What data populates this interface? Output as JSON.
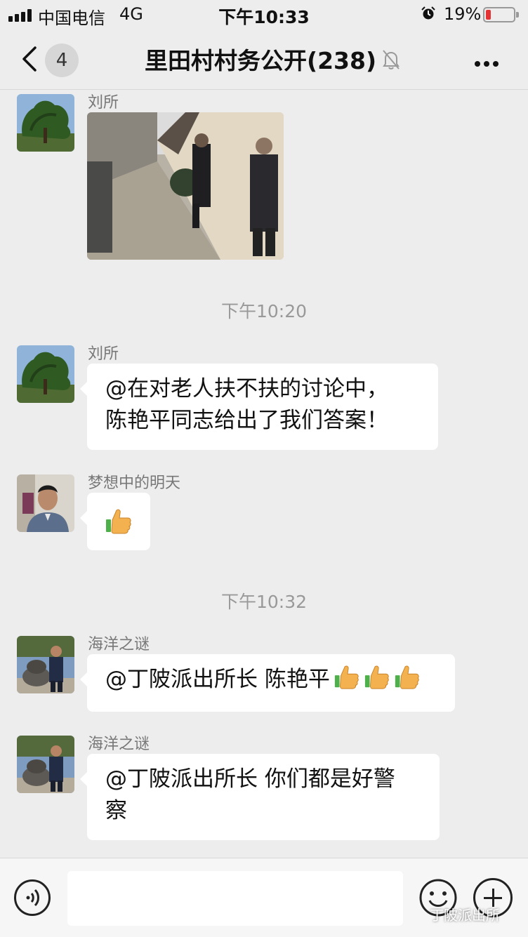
{
  "status_bar": {
    "carrier": "中国电信",
    "network": "4G",
    "time": "下午10:33",
    "battery": "19%",
    "battery_level": 0.19,
    "battery_color": "#e53333"
  },
  "nav": {
    "unread_count": "4",
    "title": "里田村村务公开(238)",
    "icons": [
      "back-arrow-icon",
      "mute-bell-icon",
      "more-icon"
    ]
  },
  "messages": [
    {
      "type": "image",
      "sender": "刘所",
      "image_desc": "street photo"
    },
    {
      "type": "time",
      "text": "下午10:20"
    },
    {
      "type": "text",
      "sender": "刘所",
      "lines": [
        "@在对老人扶不扶的讨论中，",
        "陈艳平同志给出了我们答案！"
      ]
    },
    {
      "type": "emoji",
      "sender": "梦想中的明天",
      "emoji": "thumbs-up"
    },
    {
      "type": "time",
      "text": "下午10:32"
    },
    {
      "type": "text",
      "sender": "海洋之谜",
      "text": "@丁陂派出所长 陈艳平",
      "emoji_count": 3
    },
    {
      "type": "text",
      "sender": "海洋之谜",
      "lines": [
        "@丁陂派出所长 你们都是好警",
        "察"
      ]
    }
  ],
  "input_bar": {
    "icons": [
      "voice-icon",
      "emoji-icon",
      "add-icon"
    ]
  },
  "watermark": "丁陂派出所",
  "colors": {
    "background": "#ededed",
    "bubble": "#ffffff",
    "thumb": "#f3b24f"
  }
}
